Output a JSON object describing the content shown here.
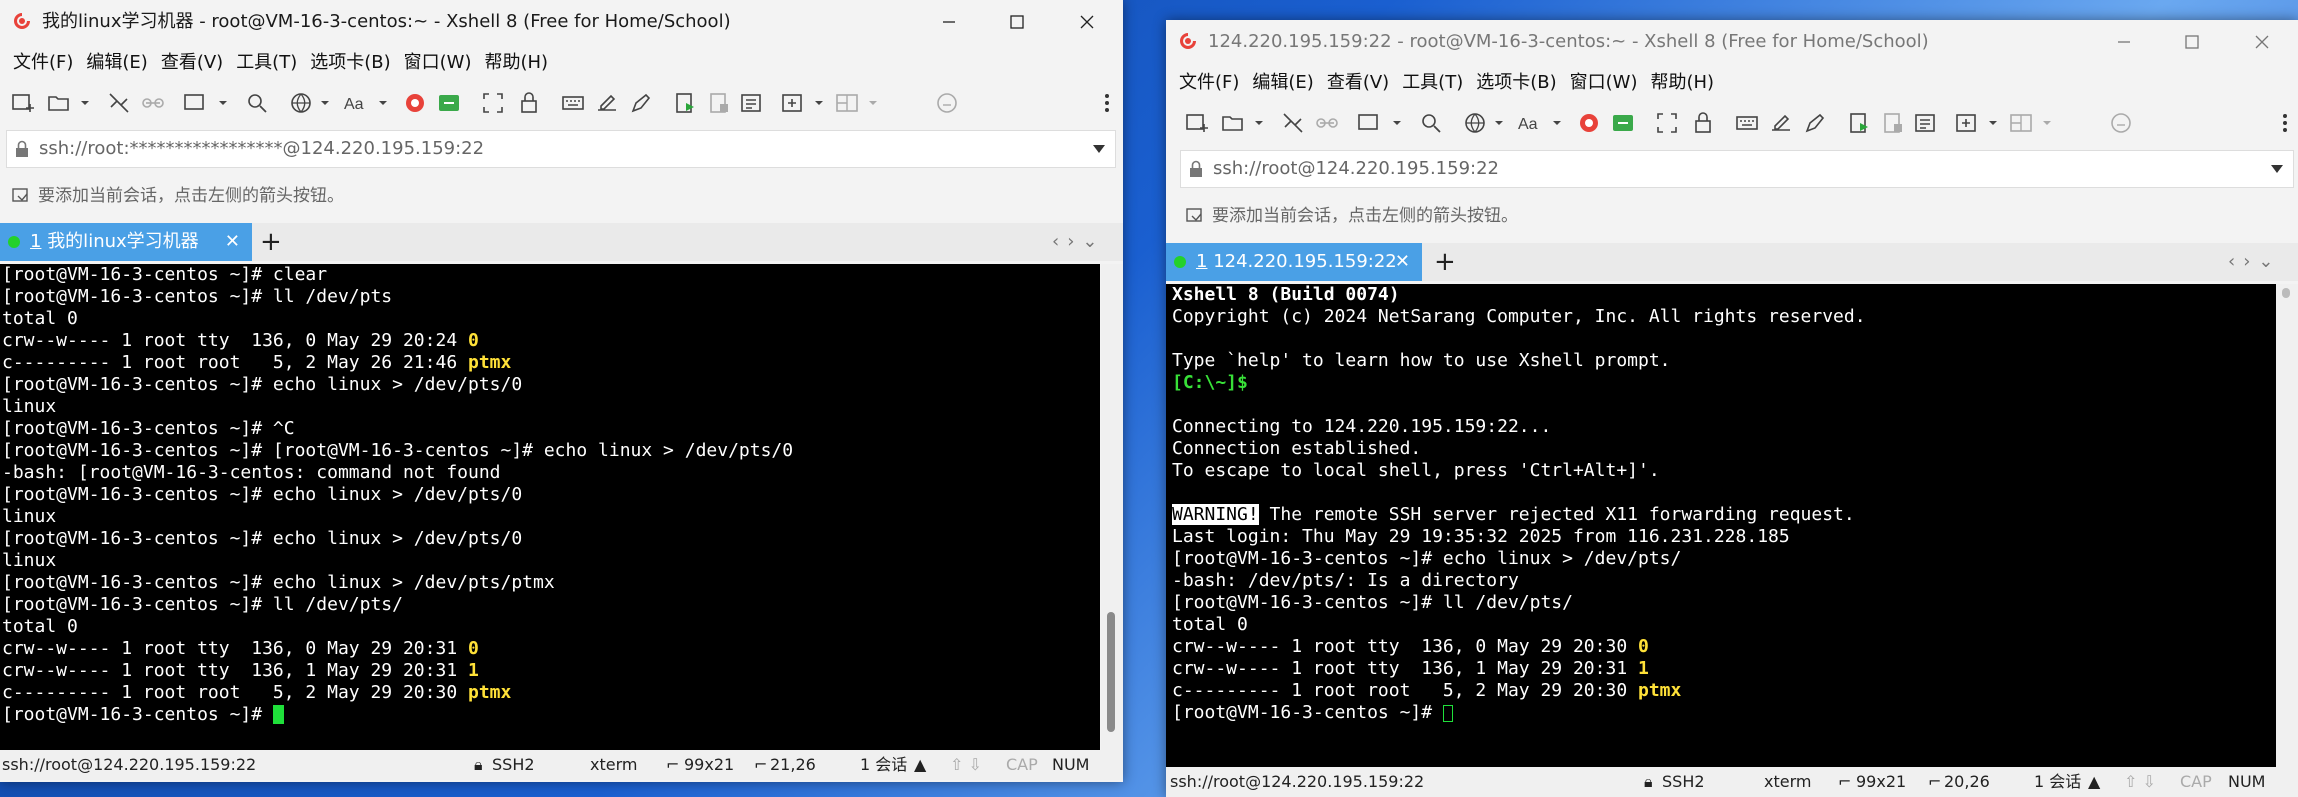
{
  "w1": {
    "title": "我的linux学习机器 - root@VM-16-3-centos:~ - Xshell 8 (Free for Home/School)",
    "menu": [
      "文件(F)",
      "编辑(E)",
      "查看(V)",
      "工具(T)",
      "选项卡(B)",
      "窗口(W)",
      "帮助(H)"
    ],
    "address": "ssh://root:*****************@124.220.195.159:22",
    "hint": "要添加当前会话，点击左侧的箭头按钮。",
    "tab_num": "1",
    "tab_label": "我的linux学习机器",
    "terminal": [
      {
        "t": "[root@VM-16-3-centos ~]# clear"
      },
      {
        "t": "[root@VM-16-3-centos ~]# ll /dev/pts"
      },
      {
        "t": "total 0"
      },
      {
        "t": "crw--w---- 1 root tty  136, 0 May 29 20:24 ",
        "h": "0",
        "c": "y"
      },
      {
        "t": "c--------- 1 root root   5, 2 May 26 21:46 ",
        "h": "ptmx",
        "c": "y"
      },
      {
        "t": "[root@VM-16-3-centos ~]# echo linux > /dev/pts/0"
      },
      {
        "t": "linux"
      },
      {
        "t": "[root@VM-16-3-centos ~]# ^C"
      },
      {
        "t": "[root@VM-16-3-centos ~]# [root@VM-16-3-centos ~]# echo linux > /dev/pts/0"
      },
      {
        "t": "-bash: [root@VM-16-3-centos: command not found"
      },
      {
        "t": "[root@VM-16-3-centos ~]# echo linux > /dev/pts/0"
      },
      {
        "t": "linux"
      },
      {
        "t": "[root@VM-16-3-centos ~]# echo linux > /dev/pts/0"
      },
      {
        "t": "linux"
      },
      {
        "t": "[root@VM-16-3-centos ~]# echo linux > /dev/pts/ptmx"
      },
      {
        "t": "[root@VM-16-3-centos ~]# ll /dev/pts/"
      },
      {
        "t": "total 0"
      },
      {
        "t": "crw--w---- 1 root tty  136, 0 May 29 20:31 ",
        "h": "0",
        "c": "y"
      },
      {
        "t": "crw--w---- 1 root tty  136, 1 May 29 20:31 ",
        "h": "1",
        "c": "y"
      },
      {
        "t": "c--------- 1 root root   5, 2 May 29 20:30 ",
        "h": "ptmx",
        "c": "y"
      },
      {
        "t": "[root@VM-16-3-centos ~]# ",
        "cursor": "solid"
      }
    ],
    "status": {
      "host": "ssh://root@124.220.195.159:22",
      "proto": "SSH2",
      "term": "xterm",
      "size": "99x21",
      "pos": "21,26",
      "sessions": "1 会话",
      "cap": "CAP",
      "num": "NUM"
    }
  },
  "w2": {
    "title": "124.220.195.159:22 - root@VM-16-3-centos:~ - Xshell 8 (Free for Home/School)",
    "menu": [
      "文件(F)",
      "编辑(E)",
      "查看(V)",
      "工具(T)",
      "选项卡(B)",
      "窗口(W)",
      "帮助(H)"
    ],
    "address": "ssh://root@124.220.195.159:22",
    "hint": "要添加当前会话，点击左侧的箭头按钮。",
    "tab_num": "1",
    "tab_label": "124.220.195.159:22",
    "terminal": [
      {
        "t": "Xshell 8 (Build 0074)",
        "c": "b"
      },
      {
        "t": "Copyright (c) 2024 NetSarang Computer, Inc. All rights reserved."
      },
      {
        "t": ""
      },
      {
        "t": "Type `help' to learn how to use Xshell prompt."
      },
      {
        "t": "",
        "h": "[C:\\~]$",
        "c": "g"
      },
      {
        "t": ""
      },
      {
        "t": "Connecting to 124.220.195.159:22..."
      },
      {
        "t": "Connection established."
      },
      {
        "t": "To escape to local shell, press 'Ctrl+Alt+]'."
      },
      {
        "t": ""
      },
      {
        "pre": "WARNING!",
        "t": " The remote SSH server rejected X11 forwarding request."
      },
      {
        "t": "Last login: Thu May 29 19:35:32 2025 from 116.231.228.185"
      },
      {
        "t": "[root@VM-16-3-centos ~]# echo linux > /dev/pts/"
      },
      {
        "t": "-bash: /dev/pts/: Is a directory"
      },
      {
        "t": "[root@VM-16-3-centos ~]# ll /dev/pts/"
      },
      {
        "t": "total 0"
      },
      {
        "t": "crw--w---- 1 root tty  136, 0 May 29 20:30 ",
        "h": "0",
        "c": "y"
      },
      {
        "t": "crw--w---- 1 root tty  136, 1 May 29 20:31 ",
        "h": "1",
        "c": "y"
      },
      {
        "t": "c--------- 1 root root   5, 2 May 29 20:30 ",
        "h": "ptmx",
        "c": "y"
      },
      {
        "t": "[root@VM-16-3-centos ~]# ",
        "cursor": "outline"
      }
    ],
    "status": {
      "host": "ssh://root@124.220.195.159:22",
      "proto": "SSH2",
      "term": "xterm",
      "size": "99x21",
      "pos": "20,26",
      "sessions": "1 会话",
      "cap": "CAP",
      "num": "NUM"
    }
  },
  "colors": {
    "tab_active": "#4aa0e6",
    "session_dot": "#24d12b",
    "terminal_bg": "#000000",
    "highlight": "#ffe138",
    "prompt_green": "#38e038",
    "cursor": "#1fe03a"
  }
}
